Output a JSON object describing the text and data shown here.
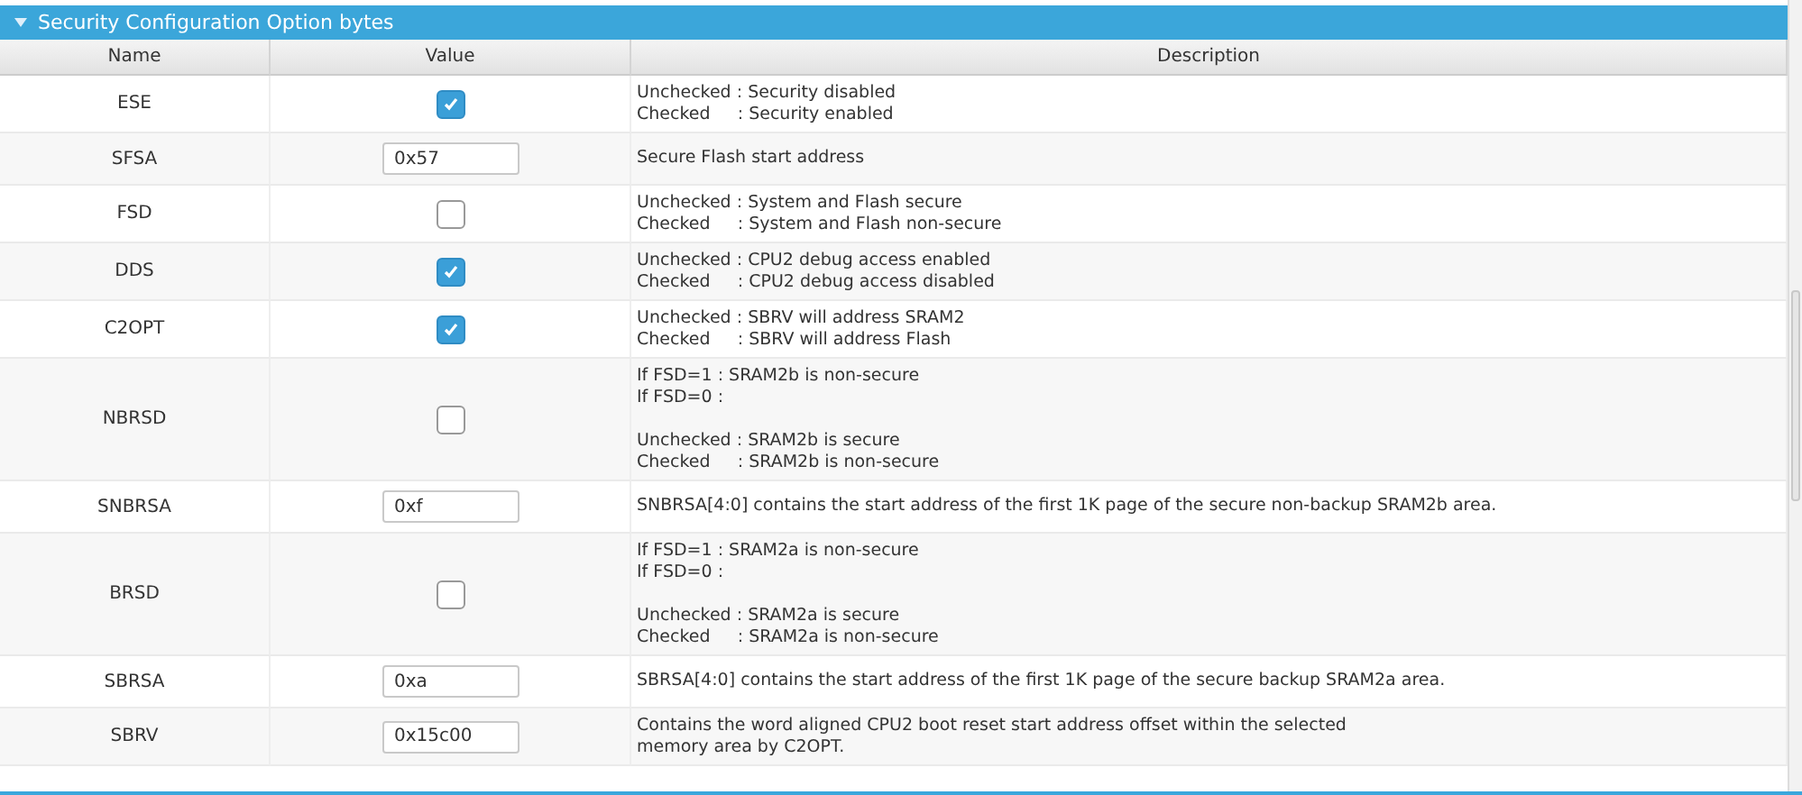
{
  "section": {
    "title": "Security Configuration Option bytes",
    "expanded": true
  },
  "table": {
    "columns": [
      "Name",
      "Value",
      "Description"
    ],
    "rows": [
      {
        "name": "ESE",
        "kind": "checkbox",
        "checked": true,
        "description": [
          [
            "Unchecked : Security disabled",
            "Checked     : Security enabled"
          ]
        ]
      },
      {
        "name": "SFSA",
        "kind": "field",
        "value": "0x57",
        "description": [
          [
            "Secure Flash start address"
          ]
        ]
      },
      {
        "name": "FSD",
        "kind": "checkbox",
        "checked": false,
        "description": [
          [
            "Unchecked : System and Flash secure",
            "Checked     : System and Flash non-secure"
          ]
        ]
      },
      {
        "name": "DDS",
        "kind": "checkbox",
        "checked": true,
        "description": [
          [
            "Unchecked : CPU2 debug access enabled",
            "Checked     : CPU2 debug access disabled"
          ]
        ]
      },
      {
        "name": "C2OPT",
        "kind": "checkbox",
        "checked": true,
        "description": [
          [
            "Unchecked : SBRV will address SRAM2",
            "Checked     : SBRV will address Flash"
          ]
        ]
      },
      {
        "name": "NBRSD",
        "kind": "checkbox",
        "checked": false,
        "description": [
          [
            "If FSD=1 : SRAM2b is non-secure",
            "If FSD=0 :"
          ],
          [
            "Unchecked : SRAM2b is secure",
            "Checked     : SRAM2b is non-secure"
          ]
        ]
      },
      {
        "name": "SNBRSA",
        "kind": "field",
        "value": "0xf",
        "description": [
          [
            "SNBRSA[4:0] contains the start address of the first 1K page of the secure non-backup SRAM2b area."
          ]
        ]
      },
      {
        "name": "BRSD",
        "kind": "checkbox",
        "checked": false,
        "description": [
          [
            "If FSD=1 : SRAM2a is non-secure",
            "If FSD=0 :"
          ],
          [
            "Unchecked : SRAM2a is secure",
            "Checked     : SRAM2a is non-secure"
          ]
        ]
      },
      {
        "name": "SBRSA",
        "kind": "field",
        "value": "0xa",
        "description": [
          [
            "SBRSA[4:0] contains the start address of the first 1K page of the secure backup SRAM2a area."
          ]
        ]
      },
      {
        "name": "SBRV",
        "kind": "field",
        "value": "0x15c00",
        "description": [
          [
            "Contains the word aligned CPU2 boot reset start address offset within the selected",
            "memory area by C2OPT."
          ]
        ]
      }
    ]
  }
}
